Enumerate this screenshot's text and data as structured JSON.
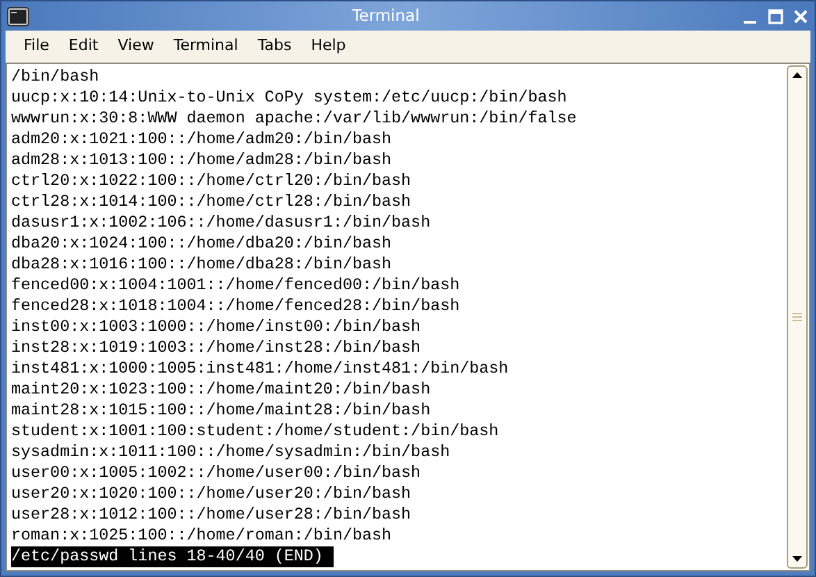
{
  "window": {
    "title": "Terminal"
  },
  "menu": [
    {
      "label": "File"
    },
    {
      "label": "Edit"
    },
    {
      "label": "View"
    },
    {
      "label": "Terminal"
    },
    {
      "label": "Tabs"
    },
    {
      "label": "Help"
    }
  ],
  "terminal": {
    "lines": [
      "/bin/bash",
      "uucp:x:10:14:Unix-to-Unix CoPy system:/etc/uucp:/bin/bash",
      "wwwrun:x:30:8:WWW daemon apache:/var/lib/wwwrun:/bin/false",
      "adm20:x:1021:100::/home/adm20:/bin/bash",
      "adm28:x:1013:100::/home/adm28:/bin/bash",
      "ctrl20:x:1022:100::/home/ctrl20:/bin/bash",
      "ctrl28:x:1014:100::/home/ctrl28:/bin/bash",
      "dasusr1:x:1002:106::/home/dasusr1:/bin/bash",
      "dba20:x:1024:100::/home/dba20:/bin/bash",
      "dba28:x:1016:100::/home/dba28:/bin/bash",
      "fenced00:x:1004:1001::/home/fenced00:/bin/bash",
      "fenced28:x:1018:1004::/home/fenced28:/bin/bash",
      "inst00:x:1003:1000::/home/inst00:/bin/bash",
      "inst28:x:1019:1003::/home/inst28:/bin/bash",
      "inst481:x:1000:1005:inst481:/home/inst481:/bin/bash",
      "maint20:x:1023:100::/home/maint20:/bin/bash",
      "maint28:x:1015:100::/home/maint28:/bin/bash",
      "student:x:1001:100:student:/home/student:/bin/bash",
      "sysadmin:x:1011:100::/home/sysadmin:/bin/bash",
      "user00:x:1005:1002::/home/user00:/bin/bash",
      "user20:x:1020:100::/home/user20:/bin/bash",
      "user28:x:1012:100::/home/user28:/bin/bash",
      "roman:x:1025:100::/home/roman:/bin/bash"
    ],
    "status": "/etc/passwd lines 18-40/40 (END)"
  }
}
